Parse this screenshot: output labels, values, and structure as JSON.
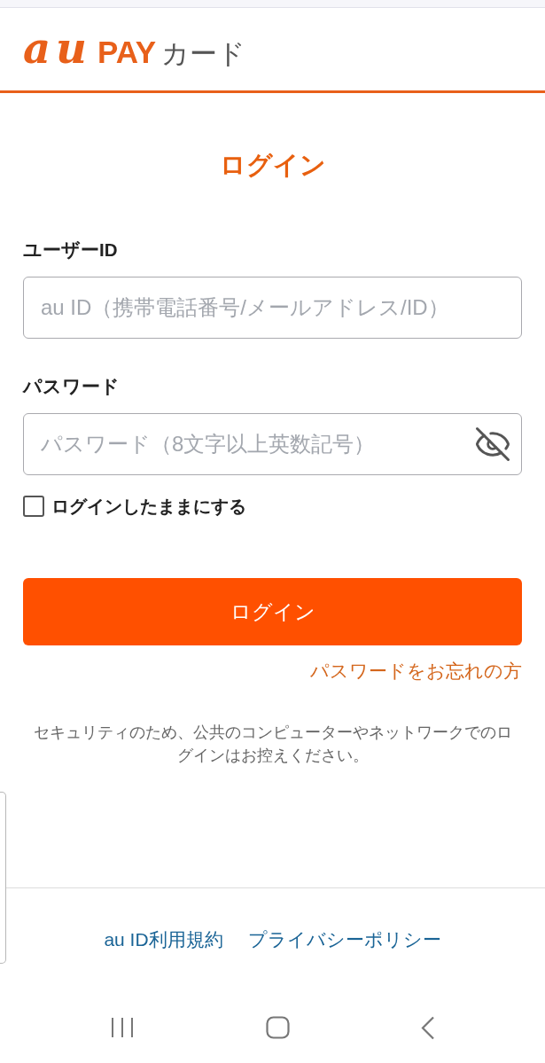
{
  "header": {
    "logo": {
      "brand": "au",
      "product": "PAY",
      "suffix": "カード"
    }
  },
  "title": "ログイン",
  "form": {
    "fields": [
      {
        "kind": "text",
        "label": "ユーザーID",
        "placeholder": "au ID（携帯電話番号/メールアドレス/ID）"
      },
      {
        "kind": "password",
        "label": "パスワード",
        "placeholder": "パスワード（8文字以上英数記号）"
      }
    ],
    "remember": {
      "label": "ログインしたままにする",
      "checked": false
    },
    "submit": "ログイン",
    "forgot_link": "パスワードをお忘れの方",
    "notice": "セキュリティのため、公共のコンピューターやネットワークでのログインはお控えください。"
  },
  "footer_links": [
    "au ID利用規約",
    "プライバシーポリシー"
  ]
}
